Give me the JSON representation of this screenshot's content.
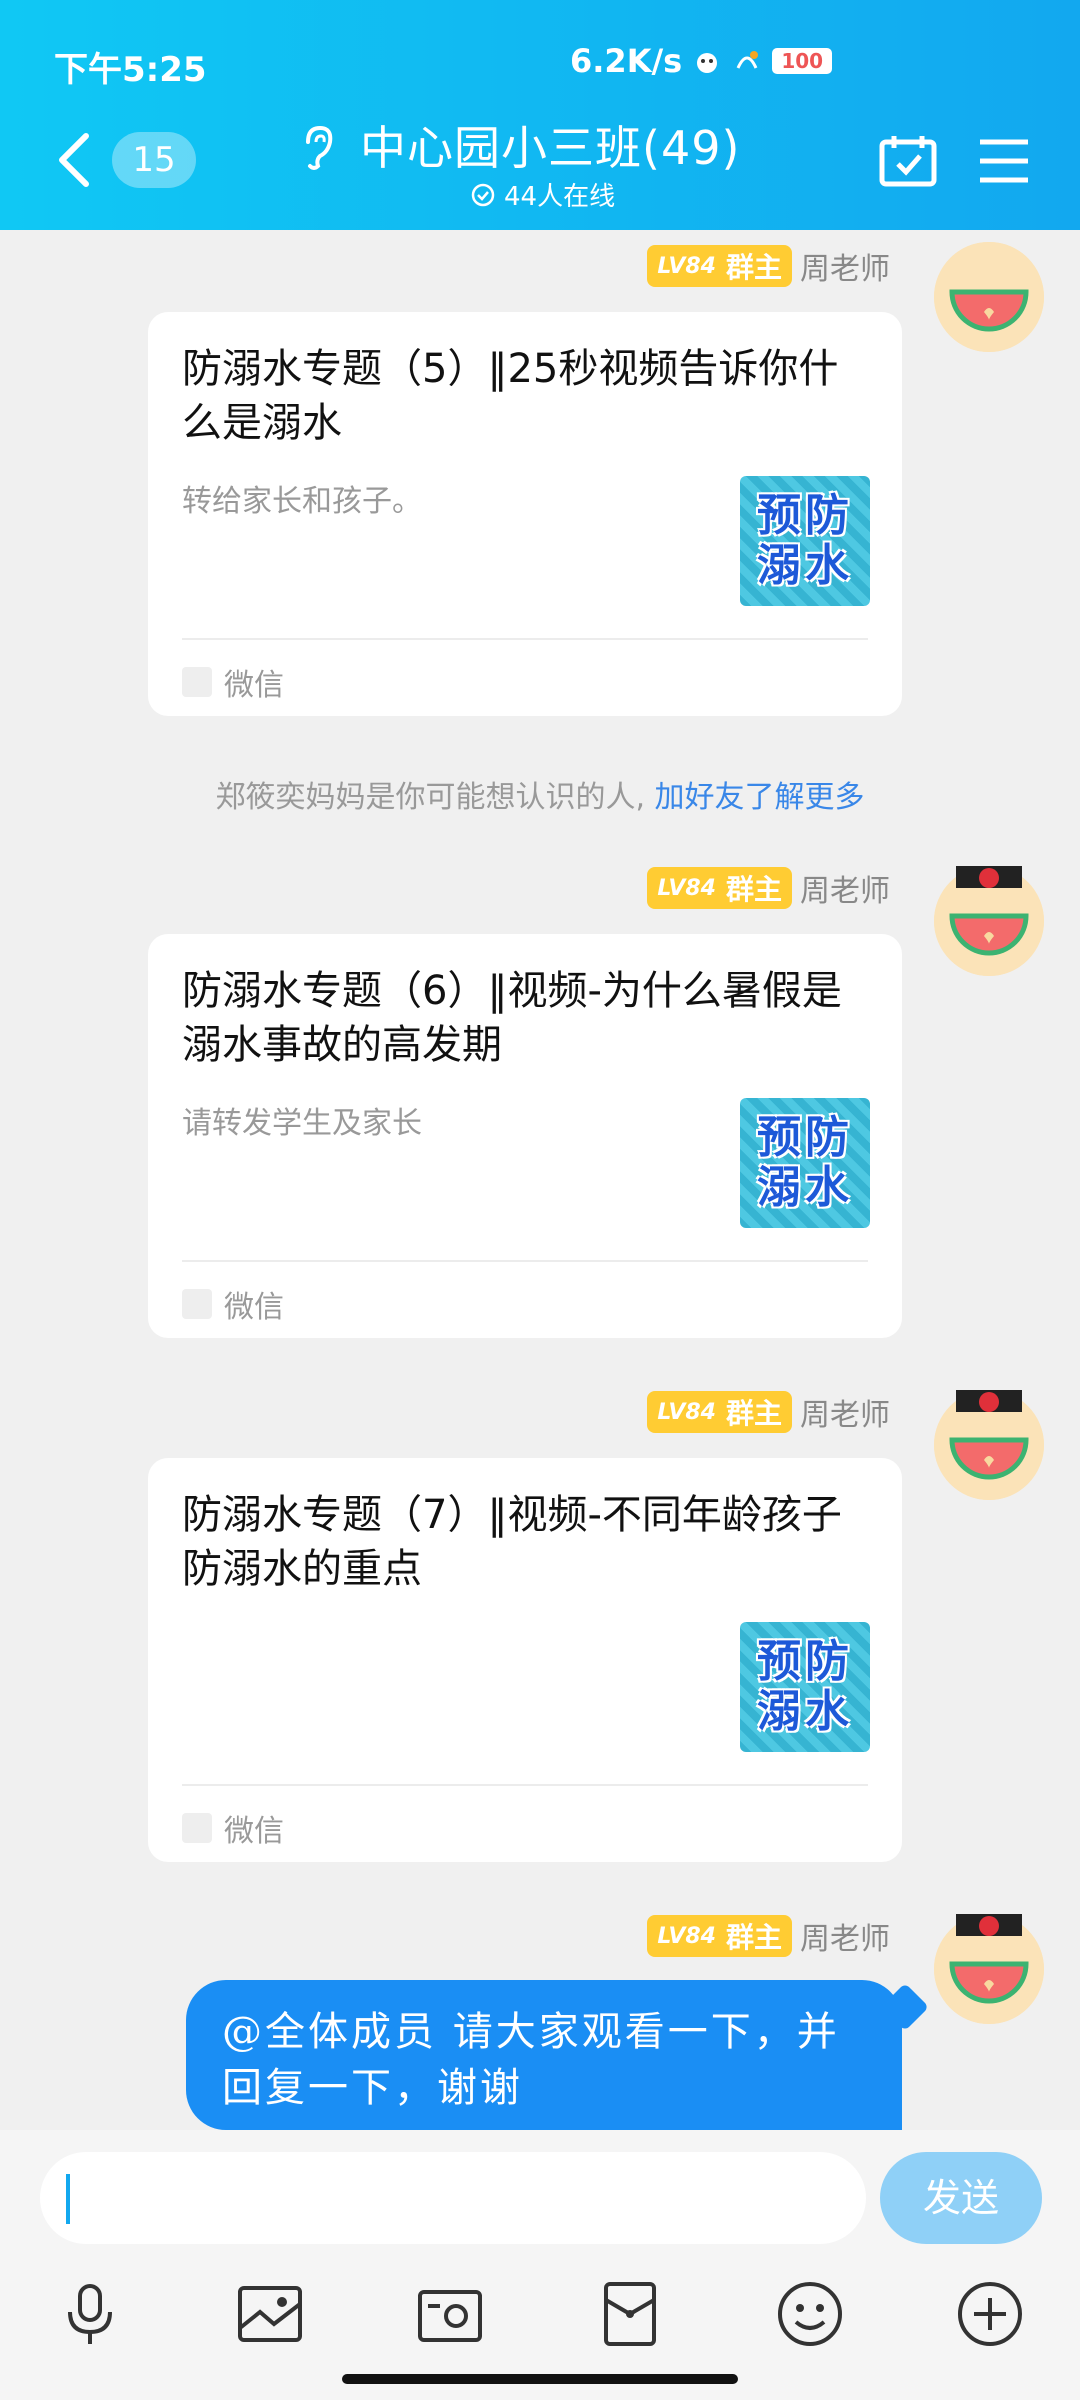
{
  "status_bar": {
    "time": "下午5:25",
    "network_speed": "6.2K/s",
    "battery": "100"
  },
  "header": {
    "back_label": "<",
    "unread_count": "15",
    "title": "中心园小三班(49)",
    "online_status": "44人在线"
  },
  "messages": [
    {
      "level": "LV84",
      "role": "群主",
      "sender": "周老师",
      "card": {
        "title": "防溺水专题（5）‖25秒视频告诉你什么是溺水",
        "description": "转给家长和孩子。",
        "thumbnail_text": [
          "预防",
          "溺水"
        ],
        "source": "微信"
      }
    },
    {
      "level": "LV84",
      "role": "群主",
      "sender": "周老师",
      "card": {
        "title": "防溺水专题（6）‖视频-为什么暑假是溺水事故的高发期",
        "description": "请转发学生及家长",
        "thumbnail_text": [
          "预防",
          "溺水"
        ],
        "source": "微信"
      }
    },
    {
      "level": "LV84",
      "role": "群主",
      "sender": "周老师",
      "card": {
        "title": "防溺水专题（7）‖视频-不同年龄孩子防溺水的重点",
        "description": "",
        "thumbnail_text": [
          "预防",
          "溺水"
        ],
        "source": "微信"
      }
    },
    {
      "level": "LV84",
      "role": "群主",
      "sender": "周老师",
      "text": "@全体成员 请大家观看一下，并回复一下，谢谢"
    }
  ],
  "system_tip": {
    "text": "郑筱奕妈妈是你可能想认识的人,",
    "link": "加好友了解更多"
  },
  "input": {
    "value": "",
    "send_label": "发送"
  },
  "toolbar": {
    "icons": [
      "microphone-icon",
      "image-icon",
      "camera-icon",
      "red-packet-icon",
      "emoji-icon",
      "plus-icon"
    ]
  },
  "colors": {
    "header_gradient_start": "#10c8f4",
    "header_gradient_end": "#12a8ef",
    "bubble": "#1a8ef4",
    "level_badge": "#ffcc33",
    "link": "#3987e8",
    "send_button": "#8fd0f7"
  }
}
